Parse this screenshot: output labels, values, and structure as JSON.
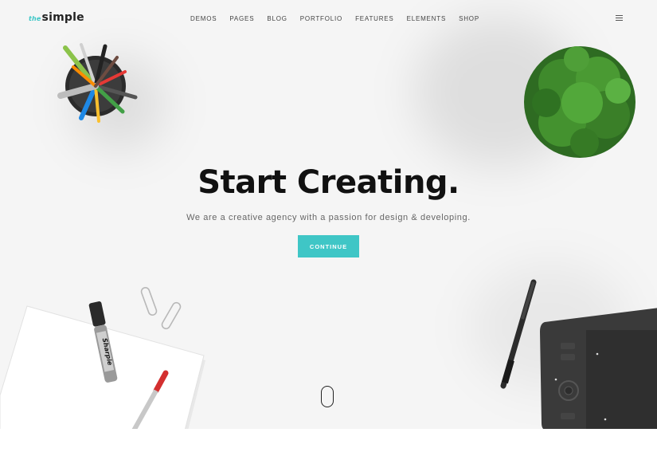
{
  "brand": {
    "prefix": "the",
    "name": "simple"
  },
  "nav": {
    "items": [
      {
        "label": "DEMOS"
      },
      {
        "label": "PAGES"
      },
      {
        "label": "BLOG"
      },
      {
        "label": "PORTFOLIO"
      },
      {
        "label": "FEATURES"
      },
      {
        "label": "ELEMENTS"
      },
      {
        "label": "SHOP"
      }
    ],
    "menu_icon": "hamburger-menu-icon"
  },
  "hero": {
    "headline": "Start Creating.",
    "subline": "We are a creative agency with a passion for design & developing.",
    "cta_label": "CONTINUE",
    "scroll_icon": "mouse-scroll-icon"
  },
  "colors": {
    "accent": "#3fc6c6",
    "background": "#f5f5f5",
    "headline": "#111111"
  },
  "decorations": {
    "pencil_cup": "pencil-cup-image",
    "plant": "potted-plant-image",
    "paper": "paper-stack-image",
    "marker": "sharpie-marker-image",
    "marker_label": "Sharpie",
    "pencil": "red-pencil-image",
    "paperclips": "paperclips-image",
    "stylus": "stylus-pen-image",
    "tablet": "drawing-tablet-image"
  }
}
